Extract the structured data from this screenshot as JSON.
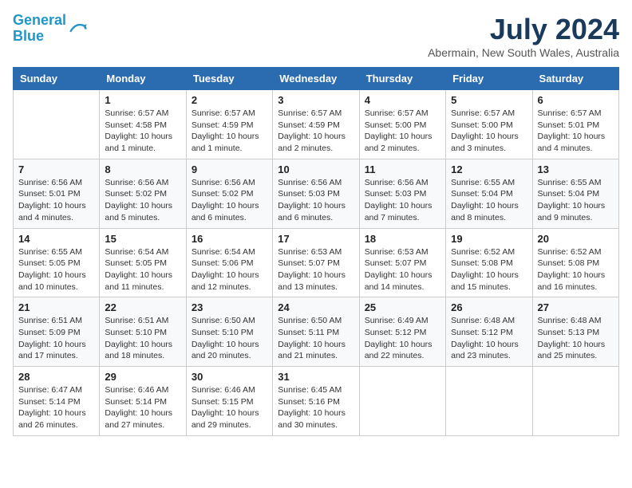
{
  "header": {
    "logo_line1": "General",
    "logo_line2": "Blue",
    "month_title": "July 2024",
    "location": "Abermain, New South Wales, Australia"
  },
  "days_of_week": [
    "Sunday",
    "Monday",
    "Tuesday",
    "Wednesday",
    "Thursday",
    "Friday",
    "Saturday"
  ],
  "weeks": [
    [
      {
        "day": "",
        "info": ""
      },
      {
        "day": "1",
        "info": "Sunrise: 6:57 AM\nSunset: 4:58 PM\nDaylight: 10 hours\nand 1 minute."
      },
      {
        "day": "2",
        "info": "Sunrise: 6:57 AM\nSunset: 4:59 PM\nDaylight: 10 hours\nand 1 minute."
      },
      {
        "day": "3",
        "info": "Sunrise: 6:57 AM\nSunset: 4:59 PM\nDaylight: 10 hours\nand 2 minutes."
      },
      {
        "day": "4",
        "info": "Sunrise: 6:57 AM\nSunset: 5:00 PM\nDaylight: 10 hours\nand 2 minutes."
      },
      {
        "day": "5",
        "info": "Sunrise: 6:57 AM\nSunset: 5:00 PM\nDaylight: 10 hours\nand 3 minutes."
      },
      {
        "day": "6",
        "info": "Sunrise: 6:57 AM\nSunset: 5:01 PM\nDaylight: 10 hours\nand 4 minutes."
      }
    ],
    [
      {
        "day": "7",
        "info": "Sunrise: 6:56 AM\nSunset: 5:01 PM\nDaylight: 10 hours\nand 4 minutes."
      },
      {
        "day": "8",
        "info": "Sunrise: 6:56 AM\nSunset: 5:02 PM\nDaylight: 10 hours\nand 5 minutes."
      },
      {
        "day": "9",
        "info": "Sunrise: 6:56 AM\nSunset: 5:02 PM\nDaylight: 10 hours\nand 6 minutes."
      },
      {
        "day": "10",
        "info": "Sunrise: 6:56 AM\nSunset: 5:03 PM\nDaylight: 10 hours\nand 6 minutes."
      },
      {
        "day": "11",
        "info": "Sunrise: 6:56 AM\nSunset: 5:03 PM\nDaylight: 10 hours\nand 7 minutes."
      },
      {
        "day": "12",
        "info": "Sunrise: 6:55 AM\nSunset: 5:04 PM\nDaylight: 10 hours\nand 8 minutes."
      },
      {
        "day": "13",
        "info": "Sunrise: 6:55 AM\nSunset: 5:04 PM\nDaylight: 10 hours\nand 9 minutes."
      }
    ],
    [
      {
        "day": "14",
        "info": "Sunrise: 6:55 AM\nSunset: 5:05 PM\nDaylight: 10 hours\nand 10 minutes."
      },
      {
        "day": "15",
        "info": "Sunrise: 6:54 AM\nSunset: 5:05 PM\nDaylight: 10 hours\nand 11 minutes."
      },
      {
        "day": "16",
        "info": "Sunrise: 6:54 AM\nSunset: 5:06 PM\nDaylight: 10 hours\nand 12 minutes."
      },
      {
        "day": "17",
        "info": "Sunrise: 6:53 AM\nSunset: 5:07 PM\nDaylight: 10 hours\nand 13 minutes."
      },
      {
        "day": "18",
        "info": "Sunrise: 6:53 AM\nSunset: 5:07 PM\nDaylight: 10 hours\nand 14 minutes."
      },
      {
        "day": "19",
        "info": "Sunrise: 6:52 AM\nSunset: 5:08 PM\nDaylight: 10 hours\nand 15 minutes."
      },
      {
        "day": "20",
        "info": "Sunrise: 6:52 AM\nSunset: 5:08 PM\nDaylight: 10 hours\nand 16 minutes."
      }
    ],
    [
      {
        "day": "21",
        "info": "Sunrise: 6:51 AM\nSunset: 5:09 PM\nDaylight: 10 hours\nand 17 minutes."
      },
      {
        "day": "22",
        "info": "Sunrise: 6:51 AM\nSunset: 5:10 PM\nDaylight: 10 hours\nand 18 minutes."
      },
      {
        "day": "23",
        "info": "Sunrise: 6:50 AM\nSunset: 5:10 PM\nDaylight: 10 hours\nand 20 minutes."
      },
      {
        "day": "24",
        "info": "Sunrise: 6:50 AM\nSunset: 5:11 PM\nDaylight: 10 hours\nand 21 minutes."
      },
      {
        "day": "25",
        "info": "Sunrise: 6:49 AM\nSunset: 5:12 PM\nDaylight: 10 hours\nand 22 minutes."
      },
      {
        "day": "26",
        "info": "Sunrise: 6:48 AM\nSunset: 5:12 PM\nDaylight: 10 hours\nand 23 minutes."
      },
      {
        "day": "27",
        "info": "Sunrise: 6:48 AM\nSunset: 5:13 PM\nDaylight: 10 hours\nand 25 minutes."
      }
    ],
    [
      {
        "day": "28",
        "info": "Sunrise: 6:47 AM\nSunset: 5:14 PM\nDaylight: 10 hours\nand 26 minutes."
      },
      {
        "day": "29",
        "info": "Sunrise: 6:46 AM\nSunset: 5:14 PM\nDaylight: 10 hours\nand 27 minutes."
      },
      {
        "day": "30",
        "info": "Sunrise: 6:46 AM\nSunset: 5:15 PM\nDaylight: 10 hours\nand 29 minutes."
      },
      {
        "day": "31",
        "info": "Sunrise: 6:45 AM\nSunset: 5:16 PM\nDaylight: 10 hours\nand 30 minutes."
      },
      {
        "day": "",
        "info": ""
      },
      {
        "day": "",
        "info": ""
      },
      {
        "day": "",
        "info": ""
      }
    ]
  ]
}
